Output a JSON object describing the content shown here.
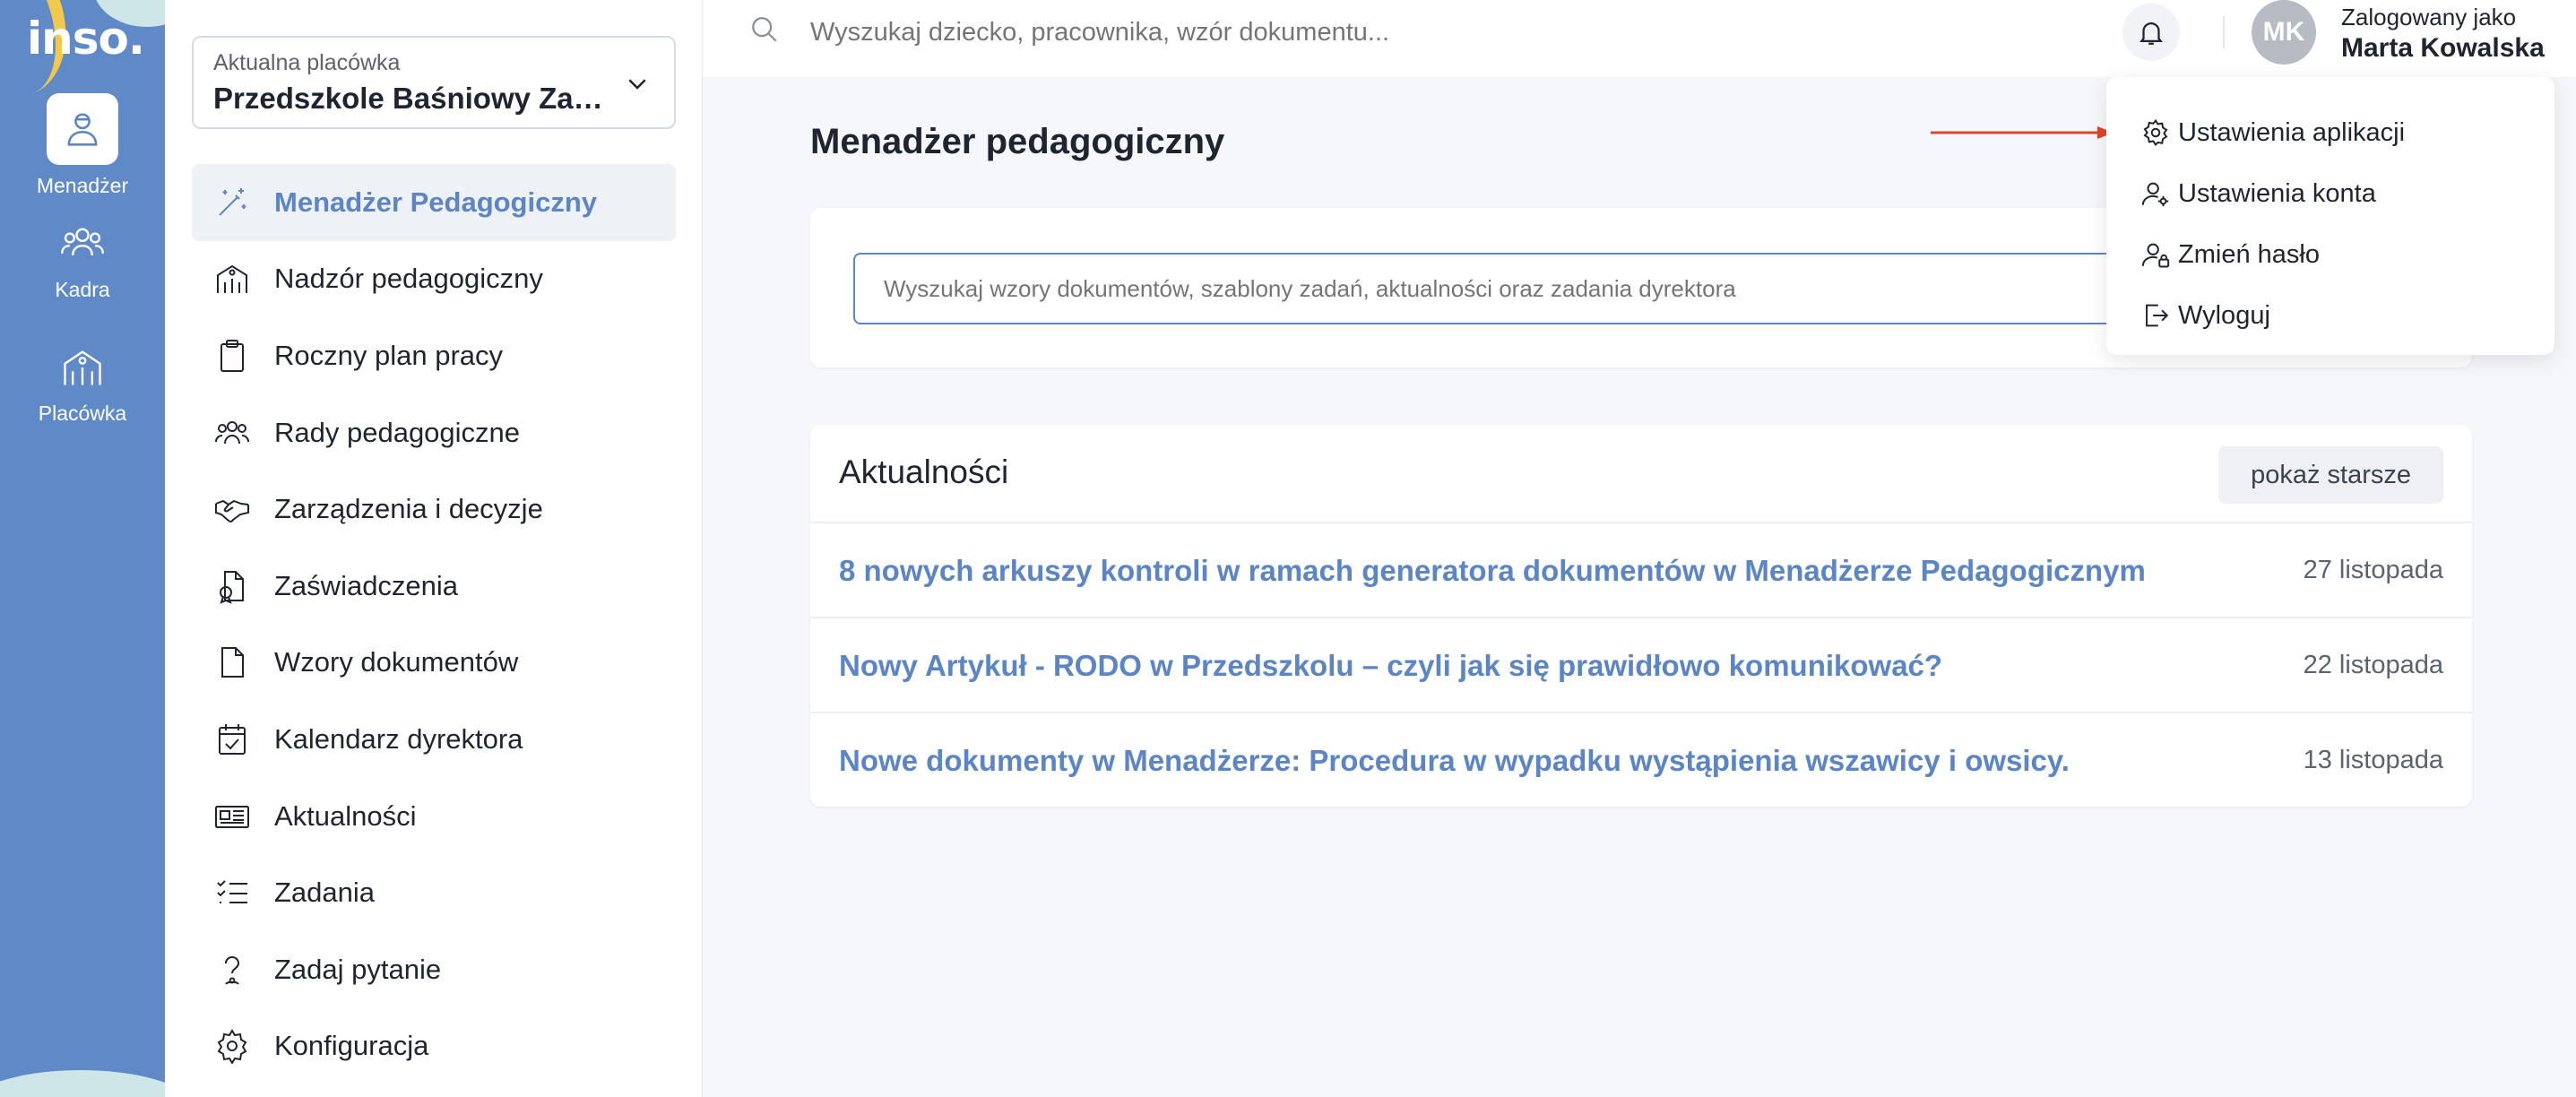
{
  "app": {
    "logo": "inso."
  },
  "rail": {
    "items": [
      {
        "label": "Menadżer",
        "icon": "manager-icon"
      },
      {
        "label": "Kadra",
        "icon": "staff-icon"
      },
      {
        "label": "Placówka",
        "icon": "building-icon"
      }
    ]
  },
  "sidebar": {
    "placowka_label": "Aktualna placówka",
    "placowka_value": "Przedszkole Baśniowy Zakątek",
    "items": [
      {
        "label": "Menadżer Pedagogiczny",
        "icon": "magic-wand-icon"
      },
      {
        "label": "Nadzór pedagogiczny",
        "icon": "building-people-icon"
      },
      {
        "label": "Roczny plan pracy",
        "icon": "clipboard-icon"
      },
      {
        "label": "Rady pedagogiczne",
        "icon": "group-icon"
      },
      {
        "label": "Zarządzenia i decyzje",
        "icon": "handshake-icon"
      },
      {
        "label": "Zaświadczenia",
        "icon": "certificate-icon"
      },
      {
        "label": "Wzory dokumentów",
        "icon": "document-icon"
      },
      {
        "label": "Kalendarz dyrektora",
        "icon": "calendar-check-icon"
      },
      {
        "label": "Aktualności",
        "icon": "newspaper-icon"
      },
      {
        "label": "Zadania",
        "icon": "checklist-icon"
      },
      {
        "label": "Zadaj pytanie",
        "icon": "question-icon"
      },
      {
        "label": "Konfiguracja",
        "icon": "gear-icon"
      }
    ]
  },
  "topbar": {
    "search_placeholder": "Wyszukaj dziecko, pracownika, wzór dokumentu...",
    "avatar_initials": "MK",
    "logged_as_label": "Zalogowany jako",
    "user_name": "Marta Kowalska"
  },
  "main": {
    "title": "Menadżer pedagogiczny",
    "search_placeholder": "Wyszukaj wzory dokumentów, szablony zadań, aktualności oraz zadania dyrektora",
    "news": {
      "title": "Aktualności",
      "older_button": "pokaż starsze",
      "items": [
        {
          "title": "8 nowych arkuszy kontroli w ramach generatora dokumentów w Menadżerze Pedagogicznym",
          "date": "27 listopada"
        },
        {
          "title": "Nowy Artykuł - RODO w Przedszkolu – czyli jak się prawidłowo komunikować?",
          "date": "22 listopada"
        },
        {
          "title": "Nowe dokumenty w Menadżerze: Procedura w wypadku wystąpienia wszawicy i owsicy.",
          "date": "13 listopada"
        }
      ]
    }
  },
  "dropdown": {
    "items": [
      {
        "label": "Ustawienia aplikacji",
        "icon": "gear-icon"
      },
      {
        "label": "Ustawienia konta",
        "icon": "user-gear-icon"
      },
      {
        "label": "Zmień hasło",
        "icon": "user-lock-icon"
      },
      {
        "label": "Wyloguj",
        "icon": "logout-icon"
      }
    ]
  },
  "colors": {
    "rail": "#5f8ac7",
    "accent": "#5b85c4",
    "annotation_arrow": "#e0442b"
  }
}
